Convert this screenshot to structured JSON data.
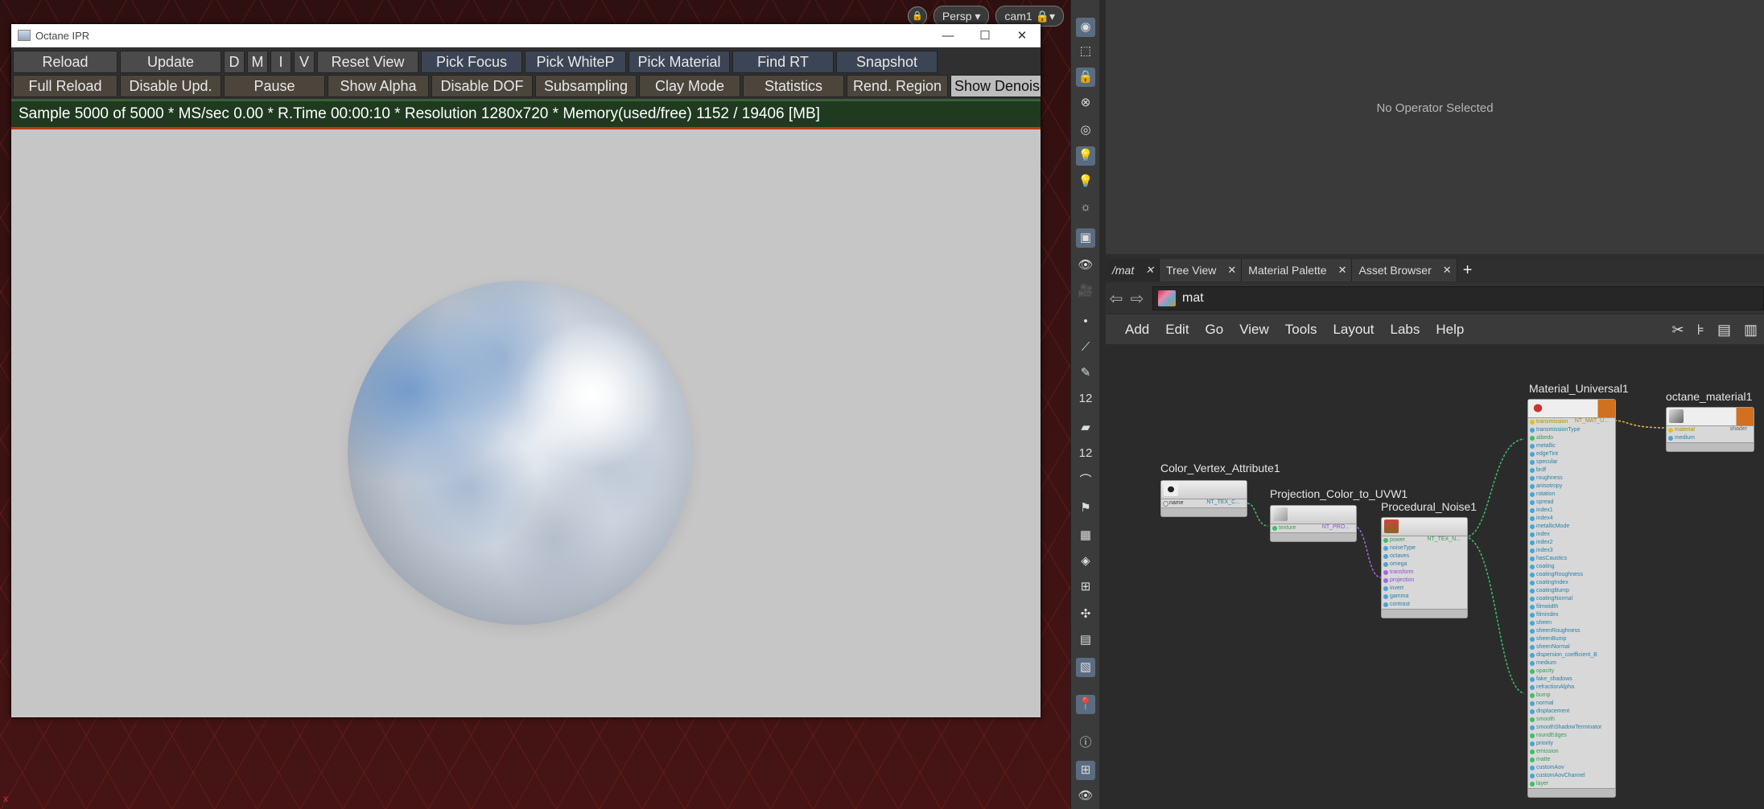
{
  "viewport": {
    "camera_menu": "Persp",
    "cam_menu": "cam1",
    "lock_icon": "lock-icon",
    "corner_marker": "x"
  },
  "ipr": {
    "title": "Octane IPR",
    "window_controls": {
      "minimize": "—",
      "maximize": "☐",
      "close": "✕"
    },
    "toolbar_row1": [
      "Reload",
      "Update",
      "D",
      "M",
      "I",
      "V",
      "Reset View",
      "Pick Focus",
      "Pick WhiteP",
      "Pick Material",
      "Find RT",
      "Snapshot"
    ],
    "toolbar_row2": [
      "Full Reload",
      "Disable Upd.",
      "Pause",
      "Show Alpha",
      "Disable DOF",
      "Subsampling",
      "Clay Mode",
      "Statistics",
      "Rend. Region",
      "Show Denoise"
    ],
    "status": "Sample 5000 of 5000 * MS/sec 0.00 * R.Time 00:00:10 * Resolution 1280x720 * Memory(used/free) 1152 / 19406 [MB]",
    "colors": {
      "status_bg": "#1f3a1f",
      "status_border": "#b83a1a"
    }
  },
  "param_pane": {
    "message": "No Operator Selected"
  },
  "tabs": [
    {
      "label": "/mat",
      "close": "✕"
    },
    {
      "label": "Tree View",
      "close": "✕"
    },
    {
      "label": "Material Palette",
      "close": "✕"
    },
    {
      "label": "Asset Browser",
      "close": "✕"
    }
  ],
  "tab_add": "+",
  "path": {
    "value": "mat",
    "back": "⇦",
    "forward": "⇨"
  },
  "menus": [
    "Add",
    "Edit",
    "Go",
    "View",
    "Tools",
    "Layout",
    "Labs",
    "Help"
  ],
  "nodes": {
    "color_vertex": {
      "title": "Color_Vertex_Attribute1",
      "output": "NT_TEX_C...",
      "inputs": [
        "name"
      ]
    },
    "projection": {
      "title": "Projection_Color_to_UVW1",
      "output": "NT_PRO...",
      "inputs": [
        "texture"
      ]
    },
    "noise": {
      "title": "Procedural_Noise1",
      "output": "NT_TEX_N...",
      "inputs": [
        "power",
        "noiseType",
        "octaves",
        "omega",
        "transform",
        "projection",
        "invert",
        "gamma",
        "contrast"
      ]
    },
    "material": {
      "title": "Material_Universal1",
      "output": "NT_MAT_U...",
      "inputs": [
        "transmission",
        "transmissionType",
        "albedo",
        "metallic",
        "edgeTint",
        "specular",
        "brdf",
        "roughness",
        "anisotropy",
        "rotation",
        "spread",
        "index1",
        "index4",
        "metallicMode",
        "index",
        "index2",
        "index3",
        "hasCaustics",
        "coating",
        "coatingRoughness",
        "coatingIndex",
        "coatingBump",
        "coatingNormal",
        "filmwidth",
        "filmindex",
        "sheen",
        "sheenRoughness",
        "sheenBump",
        "sheenNormal",
        "dispersion_coefficient_B",
        "medium",
        "opacity",
        "fake_shadows",
        "refractionAlpha",
        "bump",
        "normal",
        "displacement",
        "smooth",
        "smoothShadowTerminator",
        "roundEdges",
        "priority",
        "emission",
        "matte",
        "customAov",
        "customAovChannel",
        "layer"
      ]
    },
    "octane_material": {
      "title": "octane_material1",
      "output": "shader",
      "inputs": [
        "material",
        "medium"
      ]
    }
  }
}
